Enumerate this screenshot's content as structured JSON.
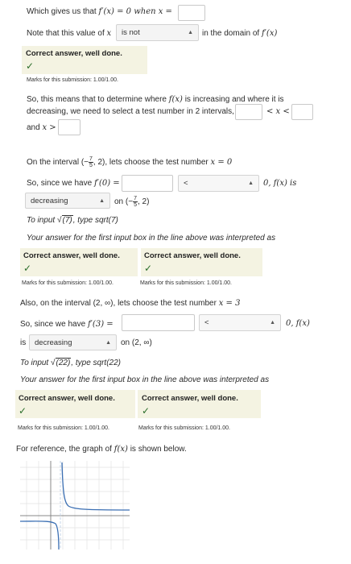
{
  "q1": {
    "prompt": "Which gives us that",
    "expr": "f′(x) = 0 when x ="
  },
  "q2": {
    "prefix": "Note that this value of",
    "var": "x",
    "select_value": "is not",
    "suffix": "in the domain of",
    "suffix_expr": "f′(x)"
  },
  "fb1": {
    "title": "Correct answer, well done.",
    "check": "✓",
    "marks": "Marks for this submission: 1.00/1.00."
  },
  "q3": {
    "line1": "So, this means that to determine where",
    "line1_expr": "f(x)",
    "line1_end": "is increasing and where it is",
    "line2": "decreasing, we need to select a test number in 2 intervals,",
    "lt1": "< x <",
    "line3": "and",
    "line3_expr": "x >"
  },
  "q4": {
    "interval_prefix": "On the interval",
    "frac_sign": "(−",
    "frac_num": "7",
    "frac_den": "5",
    "interval_end": ", 2), lets choose the test number",
    "test_expr": "x = 0",
    "since_prefix": "So, since we have",
    "since_expr": "f′(0) =",
    "sign_select": "<",
    "result": "0, f(x) is",
    "dir_select": "decreasing",
    "on_text": "on",
    "on_interval_end": ", 2)",
    "hint_prefix": "To input",
    "hint_rad": "(7)",
    "hint_suffix": ", type sqrt(7)",
    "interp": "Your answer for the first input box in the line above was interpreted as"
  },
  "fb2": {
    "title_a": "Correct answer, well done.",
    "title_b": "Correct answer, well done.",
    "check": "✓",
    "marks_a": "Marks for this submission: 1.00/1.00.",
    "marks_b": "Marks for this submission: 1.00/1.00."
  },
  "q5": {
    "interval_text": "Also, on the interval (2, ∞), lets choose the test number",
    "test_expr": "x = 3",
    "since_prefix": "So, since we have",
    "since_expr": "f′(3) =",
    "sign_select": "<",
    "result": "0, f(x)",
    "is_text": "is",
    "dir_select": "decreasing",
    "on_text": "on (2, ∞)",
    "hint_prefix": "To input",
    "hint_rad": "(22)",
    "hint_suffix": ", type sqrt(22)",
    "interp": "Your answer for the first input box in the line above was interpreted as"
  },
  "fb3": {
    "title_a": "Correct answer, well done.",
    "title_b": "Correct answer, well done.",
    "check": "✓",
    "marks_a": "Marks for this submission: 1.00/1.00.",
    "marks_b": "Marks for this submission: 1.00/1.00."
  },
  "graph": {
    "caption_prefix": "For reference, the graph of",
    "caption_expr": "f(x)",
    "caption_suffix": "is shown below."
  }
}
